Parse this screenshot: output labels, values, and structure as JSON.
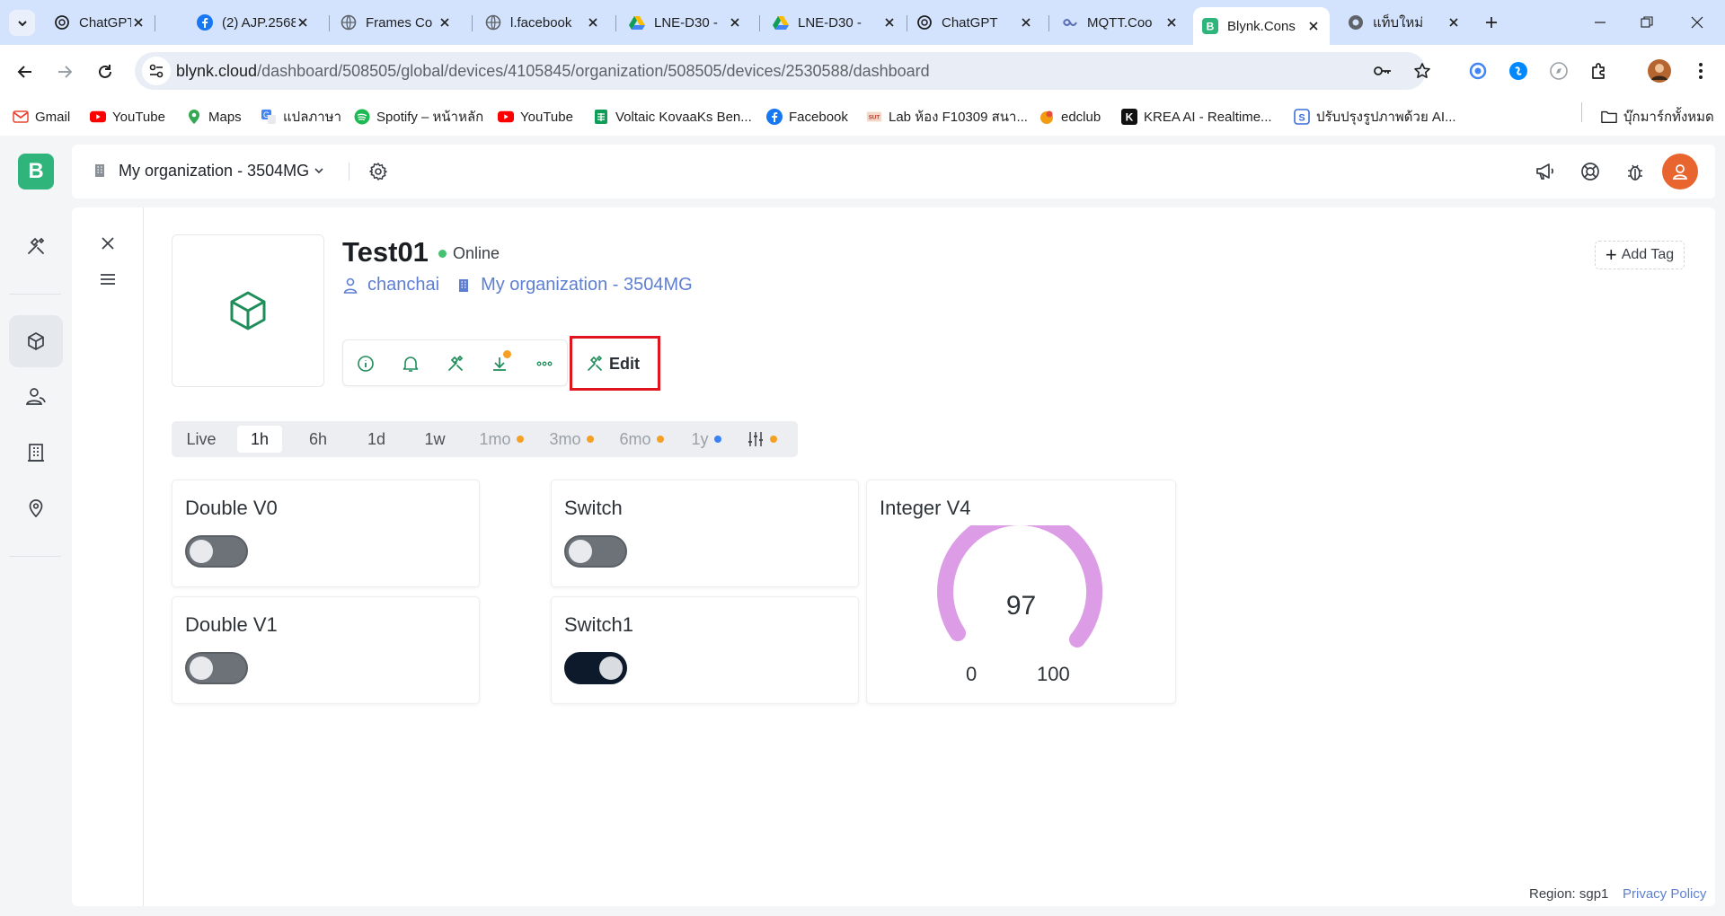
{
  "browser": {
    "tabs": [
      {
        "title": "ChatGPT",
        "icon": "openai-icon"
      },
      {
        "title": "(2) AJP.2568",
        "icon": "facebook-icon"
      },
      {
        "title": "Frames Co",
        "icon": "globe-icon"
      },
      {
        "title": "l.facebook",
        "icon": "globe-icon"
      },
      {
        "title": "LNE-D30 -",
        "icon": "google-drive-icon"
      },
      {
        "title": "LNE-D30 -",
        "icon": "google-drive-icon"
      },
      {
        "title": "ChatGPT",
        "icon": "openai-icon"
      },
      {
        "title": "MQTT.Coo",
        "icon": "mqtt-icon"
      },
      {
        "title": "Blynk.Cons",
        "icon": "blynk-icon",
        "active": true
      },
      {
        "title": "แท็บใหม่",
        "icon": "chrome-icon"
      }
    ],
    "url_host": "blynk.cloud",
    "url_path": "/dashboard/508505/global/devices/4105845/organization/508505/devices/2530588/dashboard",
    "bookmarks": [
      {
        "label": "Gmail",
        "icon": "gmail-icon"
      },
      {
        "label": "YouTube",
        "icon": "youtube-icon"
      },
      {
        "label": "Maps",
        "icon": "maps-icon"
      },
      {
        "label": "แปลภาษา",
        "icon": "translate-icon"
      },
      {
        "label": "Spotify – หน้าหลัก",
        "icon": "spotify-icon"
      },
      {
        "label": "YouTube",
        "icon": "youtube-icon"
      },
      {
        "label": "Voltaic KovaaKs Ben...",
        "icon": "sheets-icon"
      },
      {
        "label": "Facebook",
        "icon": "facebook-icon"
      },
      {
        "label": "Lab ห้อง F10309 สนา...",
        "icon": "lab-icon"
      },
      {
        "label": "edclub",
        "icon": "edclub-icon"
      },
      {
        "label": "KREA AI - Realtime...",
        "icon": "krea-icon"
      },
      {
        "label": "ปรับปรุงรูปภาพด้วย AI...",
        "icon": "enhance-icon"
      }
    ],
    "all_bookmarks": "บุ๊กมาร์กทั้งหมด"
  },
  "app": {
    "logo": "B",
    "org_name": "My organization - 3504MG",
    "device": {
      "name": "Test01",
      "status": "Online",
      "owner": "chanchai",
      "organization": "My organization - 3504MG",
      "edit_label": "Edit",
      "add_tag_label": "Add Tag"
    },
    "time_ranges": [
      {
        "label": "Live",
        "selected": false,
        "dim": false,
        "dot": null
      },
      {
        "label": "1h",
        "selected": true,
        "dim": false,
        "dot": null
      },
      {
        "label": "6h",
        "selected": false,
        "dim": false,
        "dot": null
      },
      {
        "label": "1d",
        "selected": false,
        "dim": false,
        "dot": null
      },
      {
        "label": "1w",
        "selected": false,
        "dim": false,
        "dot": null
      },
      {
        "label": "1mo",
        "selected": false,
        "dim": true,
        "dot": "#f5a023"
      },
      {
        "label": "3mo",
        "selected": false,
        "dim": true,
        "dot": "#f5a023"
      },
      {
        "label": "6mo",
        "selected": false,
        "dim": true,
        "dot": "#f5a023"
      },
      {
        "label": "1y",
        "selected": false,
        "dim": true,
        "dot": "#3b82f6"
      }
    ],
    "widgets": {
      "double_v0": {
        "title": "Double V0",
        "on": false
      },
      "double_v1": {
        "title": "Double V1",
        "on": false
      },
      "switch": {
        "title": "Switch",
        "on": false
      },
      "switch1": {
        "title": "Switch1",
        "on": true
      },
      "gauge": {
        "title": "Integer V4",
        "value": "97",
        "min": "0",
        "max": "100",
        "color": "#dc9ce6"
      }
    },
    "footer": {
      "region": "Region: sgp1",
      "privacy": "Privacy Policy"
    },
    "colors": {
      "brand": "#2fb57c",
      "link": "#5e7fd1",
      "highlight": "#e0161f"
    }
  }
}
